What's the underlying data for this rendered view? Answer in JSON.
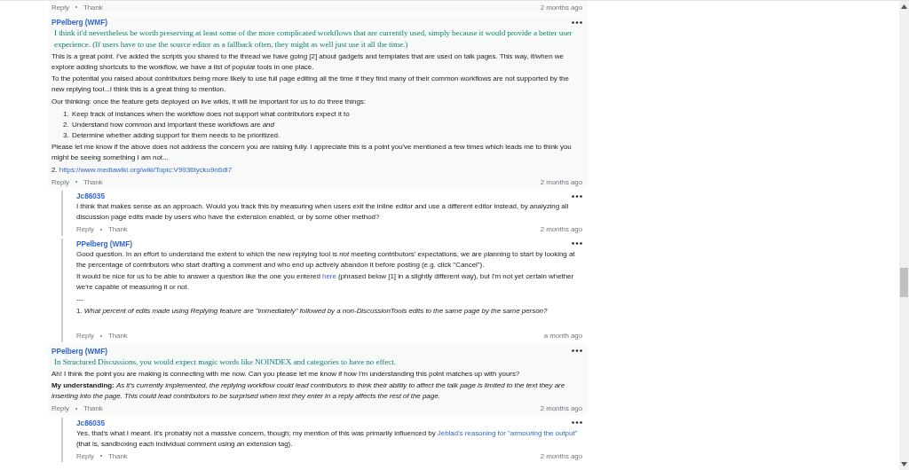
{
  "top_footer": {
    "actions": [
      "Reply",
      "Thank"
    ],
    "time": "2 months ago"
  },
  "threads": [
    {
      "author": "PPelberg (WMF)",
      "paragraphs": [
        {
          "kind": "quote",
          "parts": [
            {
              "text": "I think it'd nevertheless be worth preserving at least some of the more complicated workflows that are currently used, simply because it would provide a better user experience. (If users have to use the source editor as a fallback often, they might as well just use it all the time.)"
            }
          ]
        },
        {
          "kind": "text",
          "parts": [
            {
              "text": "This is a great point. I've added the scripts you shared to the thread we have going [2] about gadgets and templates that are used on talk pages. This way, if/when we explore adding shortcuts to the workflow, we have a list of popular tools in one place."
            }
          ]
        },
        {
          "kind": "text",
          "parts": [
            {
              "text": "To the potential you raised about contributors being more likely to use full page editing all the time if they find many of their common workflows are not supported by the new replying tool...I think this is a great thing to mention."
            }
          ]
        },
        {
          "kind": "text",
          "parts": [
            {
              "text": "Our thinking: once the feature gets deployed on live wikis, it will be important for us to do three things:"
            }
          ]
        },
        {
          "kind": "list",
          "items": [
            {
              "marker": "1.",
              "text": "Keep track of instances when the workflow does not support what contributors expect it to"
            },
            {
              "marker": "2.",
              "text": "Understand how common and important these workflows are *and*"
            },
            {
              "marker": "3.",
              "text": "Determine whether adding support for them needs to be prioritized."
            }
          ]
        },
        {
          "kind": "text",
          "parts": [
            {
              "text": "Please let me know if the above does not address the concern you are raising fully. I appreciate this is a point you've mentioned a few times which leads me to think you might be seeing something I am not..."
            }
          ]
        },
        {
          "kind": "text",
          "parts": [
            {
              "text": "2."
            },
            {
              "link": "https://www.mediawiki.org/wiki/Topic:V9936tycku9n6dt7"
            }
          ]
        }
      ],
      "footer": {
        "actions": [
          "Reply",
          "Thank"
        ],
        "time": "2 months ago"
      },
      "replies": [
        {
          "author": "Jc86035",
          "paragraphs": [
            {
              "kind": "text",
              "parts": [
                {
                  "text": "I think that makes sense as an approach. Would you track this by measuring when users exit the inline editor and use a different editor instead, by analyzing all discussion page edits made by users who have the extension enabled, or by some other method?"
                }
              ]
            }
          ],
          "footer": {
            "actions": [
              "Reply",
              "Thank"
            ],
            "time": "2 months ago"
          }
        },
        {
          "author": "PPelberg (WMF)",
          "paragraphs": [
            {
              "kind": "text",
              "parts": [
                {
                  "text": "Good question. In an effort to understand the extent to which the new replying tool is *not* meeting contributors' expectations, we are planning to start by looking at the percentage of contributors who start drafting a comment and who end up actively abandon it before posting (e.g. click \"Cancel\")."
                }
              ]
            },
            {
              "kind": "text",
              "parts": [
                {
                  "text": "It would be nice for us to be able to answer a question like the one you entered"
                },
                {
                  "link": "here"
                },
                {
                  "text": "(phrased below [1] in a slightly different way), but I'm not yet certain whether we're capable of measuring it or not."
                }
              ]
            },
            {
              "kind": "text",
              "parts": [
                {
                  "text": "---"
                }
              ]
            },
            {
              "kind": "text",
              "parts": [
                {
                  "text": "1. *What percent of edits made using Replying feature are \"immediately\" followed by a non-DiscussionTools edits to the same page by the same person?*"
                }
              ]
            }
          ],
          "footer": {
            "actions": [
              "Reply",
              "Thank"
            ],
            "time": "a month ago"
          }
        }
      ]
    },
    {
      "author": "PPelberg (WMF)",
      "paragraphs": [
        {
          "kind": "quote",
          "parts": [
            {
              "text": "In Structured Discussions, you would expect magic words like NOINDEX and categories to have no effect."
            }
          ]
        },
        {
          "kind": "text",
          "parts": [
            {
              "text": "Ah! I think the point you are making is connecting with me now. Can you please let me know if how I'm understanding this point matches up with yours?"
            }
          ]
        },
        {
          "kind": "text",
          "parts": [
            {
              "text": "**My understanding:** *As it's currently implemented, the replying workflow could lead contributors to think their ability to affect the talk page is limited to the text they are inserting into the page. This could lead contributors to be surprised when text they enter in a reply affects the rest of the page.*"
            }
          ]
        }
      ],
      "footer": {
        "actions": [
          "Reply",
          "Thank"
        ],
        "time": "2 months ago"
      },
      "replies": [
        {
          "author": "Jc86035",
          "paragraphs": [
            {
              "kind": "text",
              "parts": [
                {
                  "text": "Yes, that's what I meant. It's probably not a massive concern, though; my mention of this was primarily influenced by"
                },
                {
                  "link": "Jeblad's reasoning for \"armouring the output\""
                },
                {
                  "text": "(that is, sandboxing each individual comment using an extension tag)."
                }
              ]
            }
          ],
          "footer": {
            "actions": [
              "Reply",
              "Thank"
            ],
            "time": "2 months ago"
          }
        }
      ]
    }
  ]
}
